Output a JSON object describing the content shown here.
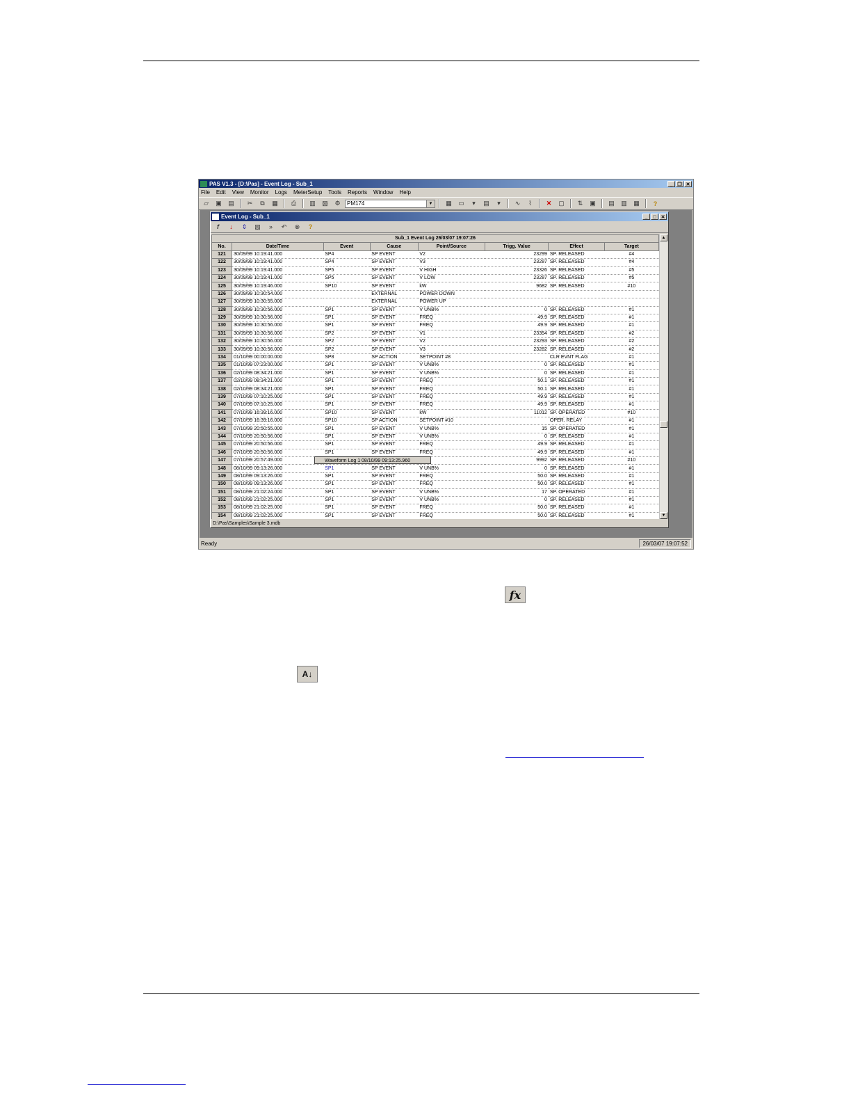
{
  "app": {
    "title": "PAS V1.3 - [D:\\Pas] - Event Log - Sub_1",
    "menu": [
      "File",
      "Edit",
      "View",
      "Monitor",
      "Logs",
      "MeterSetup",
      "Tools",
      "Reports",
      "Window",
      "Help"
    ],
    "device": "PM174",
    "status_left": "Ready",
    "status_clock": "26/03/07 19:07:52"
  },
  "child": {
    "title": "Event Log - Sub_1",
    "caption": "Sub_1   Event Log  26/03/07 19:07:26",
    "path": "D:\\Pas\\Samples\\Sample 3.mdb",
    "tooltip": "Waveform Log 1  08/10/99  09:13:25.960"
  },
  "columns": [
    "No.",
    "Date/Time",
    "Event",
    "Cause",
    "Point/Source",
    "Trigg. Value",
    "Effect",
    "Target"
  ],
  "rows": [
    [
      "121",
      "30/09/99  10:19:41.000",
      "SP4",
      "SP EVENT",
      "V2",
      "23299",
      "SP. RELEASED",
      "#4"
    ],
    [
      "122",
      "30/09/99  10:19:41.000",
      "SP4",
      "SP EVENT",
      "V3",
      "23287",
      "SP. RELEASED",
      "#4"
    ],
    [
      "123",
      "30/09/99  10:19:41.000",
      "SP5",
      "SP EVENT",
      "V HIGH",
      "23326",
      "SP. RELEASED",
      "#5"
    ],
    [
      "124",
      "30/09/99  10:19:41.000",
      "SP5",
      "SP EVENT",
      "V LOW",
      "23287",
      "SP. RELEASED",
      "#5"
    ],
    [
      "125",
      "30/09/99  10:19:46.000",
      "SP10",
      "SP EVENT",
      "kW",
      "9682",
      "SP. RELEASED",
      "#10"
    ],
    [
      "126",
      "30/09/99  10:30:54.000",
      "",
      "EXTERNAL",
      "POWER DOWN",
      "",
      "",
      ""
    ],
    [
      "127",
      "30/09/99  10:30:55.000",
      "",
      "EXTERNAL",
      "POWER UP",
      "",
      "",
      ""
    ],
    [
      "128",
      "30/09/99  10:30:56.000",
      "SP1",
      "SP EVENT",
      "V UNB%",
      "0",
      "SP. RELEASED",
      "#1"
    ],
    [
      "129",
      "30/09/99  10:30:56.000",
      "SP1",
      "SP EVENT",
      "FREQ",
      "49.9",
      "SP. RELEASED",
      "#1"
    ],
    [
      "130",
      "30/09/99  10:30:56.000",
      "SP1",
      "SP EVENT",
      "FREQ",
      "49.9",
      "SP. RELEASED",
      "#1"
    ],
    [
      "131",
      "30/09/99  10:30:56.000",
      "SP2",
      "SP EVENT",
      "V1",
      "23354",
      "SP. RELEASED",
      "#2"
    ],
    [
      "132",
      "30/09/99  10:30:56.000",
      "SP2",
      "SP EVENT",
      "V2",
      "23293",
      "SP. RELEASED",
      "#2"
    ],
    [
      "133",
      "30/09/99  10:30:56.000",
      "SP2",
      "SP EVENT",
      "V3",
      "23282",
      "SP. RELEASED",
      "#2"
    ],
    [
      "134",
      "01/10/99  00:00:00.000",
      "SP8",
      "SP ACTION",
      "SETPOINT #8",
      "",
      "CLR EVNT FLAG",
      "#1"
    ],
    [
      "135",
      "01/10/99  07:23:00.000",
      "SP1",
      "SP EVENT",
      "V UNB%",
      "0",
      "SP. RELEASED",
      "#1"
    ],
    [
      "136",
      "02/10/99  08:34:21.000",
      "SP1",
      "SP EVENT",
      "V UNB%",
      "0",
      "SP. RELEASED",
      "#1"
    ],
    [
      "137",
      "02/10/99  08:34:21.000",
      "SP1",
      "SP EVENT",
      "FREQ",
      "50.1",
      "SP. RELEASED",
      "#1"
    ],
    [
      "138",
      "02/10/99  08:34:21.000",
      "SP1",
      "SP EVENT",
      "FREQ",
      "50.1",
      "SP. RELEASED",
      "#1"
    ],
    [
      "139",
      "07/10/99  07:10:25.000",
      "SP1",
      "SP EVENT",
      "FREQ",
      "49.9",
      "SP. RELEASED",
      "#1"
    ],
    [
      "140",
      "07/10/99  07:10:25.000",
      "SP1",
      "SP EVENT",
      "FREQ",
      "49.9",
      "SP. RELEASED",
      "#1"
    ],
    [
      "141",
      "07/10/99  16:39:16.000",
      "SP10",
      "SP EVENT",
      "kW",
      "11012",
      "SP. OPERATED",
      "#10"
    ],
    [
      "142",
      "07/10/99  16:39:16.000",
      "SP10",
      "SP ACTION",
      "SETPOINT #10",
      "",
      "OPER. RELAY",
      "#1"
    ],
    [
      "143",
      "07/10/99  20:50:55.000",
      "SP1",
      "SP EVENT",
      "V UNB%",
      "15",
      "SP. OPERATED",
      "#1"
    ],
    [
      "144",
      "07/10/99  20:50:56.000",
      "SP1",
      "SP EVENT",
      "V UNB%",
      "0",
      "SP. RELEASED",
      "#1"
    ],
    [
      "145",
      "07/10/99  20:50:56.000",
      "SP1",
      "SP EVENT",
      "FREQ",
      "49.9",
      "SP. RELEASED",
      "#1"
    ],
    [
      "146",
      "07/10/99  20:50:56.000",
      "SP1",
      "SP EVENT",
      "FREQ",
      "49.9",
      "SP. RELEASED",
      "#1"
    ],
    [
      "147",
      "07/10/99  20:57:49.000",
      "SP10",
      "SP EVENT",
      "kW",
      "9992",
      "SP. RELEASED",
      "#10"
    ],
    [
      "148",
      "08/10/99  09:13:26.000",
      "SP1",
      "SP EVENT",
      "V UNB%",
      "0",
      "SP. RELEASED",
      "#1"
    ],
    [
      "149",
      "08/10/99  09:13:26.000",
      "SP1",
      "SP EVENT",
      "FREQ",
      "50.0",
      "SP. RELEASED",
      "#1"
    ],
    [
      "150",
      "08/10/99  09:13:26.000",
      "SP1",
      "SP EVENT",
      "FREQ",
      "50.0",
      "SP. RELEASED",
      "#1"
    ],
    [
      "151",
      "08/10/99  21:02:24.000",
      "SP1",
      "SP EVENT",
      "V UNB%",
      "17",
      "SP. OPERATED",
      "#1"
    ],
    [
      "152",
      "08/10/99  21:02:25.000",
      "SP1",
      "SP EVENT",
      "V UNB%",
      "0",
      "SP. RELEASED",
      "#1"
    ],
    [
      "153",
      "08/10/99  21:02:25.000",
      "SP1",
      "SP EVENT",
      "FREQ",
      "50.0",
      "SP. RELEASED",
      "#1"
    ],
    [
      "154",
      "08/10/99  21:02:25.000",
      "SP1",
      "SP EVENT",
      "FREQ",
      "50.0",
      "SP. RELEASED",
      "#1"
    ],
    [
      "155",
      "09/10/99  14:40:10.000",
      "SP1",
      "SP EVENT",
      "FREQ",
      "49.5",
      "SP. OPERATED",
      "#1"
    ],
    [
      "156",
      "09/10/99  14:40:12.000",
      "SP1",
      "SP EVENT",
      "V UNB%",
      "0",
      "SP. RELEASED",
      "#1"
    ],
    [
      "157",
      "09/10/99  14:40:12.000",
      "SP1",
      "SP EVENT",
      "FREQ",
      "50.0",
      "SP. RELEASED",
      "#1"
    ]
  ],
  "doc_icons": {
    "fx": "fx",
    "sort": "A↓"
  },
  "icons": [
    "open-icon",
    "save-icon",
    "save-all-icon",
    "cut-icon",
    "copy-icon",
    "paste-icon",
    "print-icon",
    "preview-icon",
    "properties-icon",
    "connect-icon"
  ]
}
